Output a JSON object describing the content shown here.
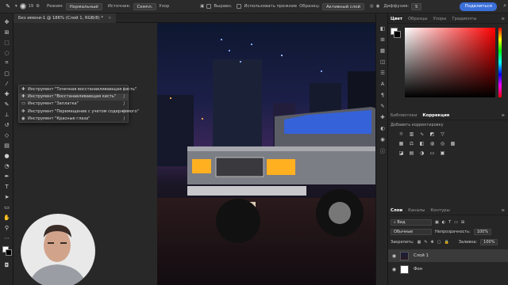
{
  "options_bar": {
    "brush_size": "19",
    "mode_label": "Режим:",
    "mode_value": "Нормальный",
    "source_label": "Источник:",
    "source_value": "Семпл.",
    "source_alt": "Узор",
    "align_label": "Выравн.",
    "use_legacy_label": "Использовать прежние",
    "sample_label": "Образец:",
    "sample_value": "Активный слой",
    "diffusion_label": "Диффузия:",
    "diffusion_value": "5",
    "share_label": "Поделиться"
  },
  "document": {
    "tab_title": "Без имени-1 @ 186% (Слой 1, RGB/8) *",
    "close_icon": "close-icon"
  },
  "fly_menu": {
    "items": [
      {
        "label": "Инструмент \"Точечная восстанавливающая кисть\"",
        "key": "J"
      },
      {
        "label": "Инструмент \"Восстанавливающая кисть\"",
        "key": "J",
        "active": true
      },
      {
        "label": "Инструмент \"Заплатка\"",
        "key": "J"
      },
      {
        "label": "Инструмент \"Перемещение с учетом содержимого\"",
        "key": "J"
      },
      {
        "label": "Инструмент \"Красные глаза\"",
        "key": "J"
      }
    ]
  },
  "photo": {
    "plate_text": "ЕЗ9-П4"
  },
  "color_panel": {
    "tabs": [
      "Цвет",
      "Образцы",
      "Узоры",
      "Градиенты"
    ],
    "active": "Цвет",
    "color_accent": "#ff0000"
  },
  "adjust_panel": {
    "tabs": [
      "Библиотеки",
      "Коррекция"
    ],
    "active": "Коррекция",
    "hint": "Добавить корректировку"
  },
  "layers_panel": {
    "tabs": [
      "Слои",
      "Каналы",
      "Контуры"
    ],
    "active": "Слои",
    "filter_placeholder": "Вид",
    "blend_mode": "Обычные",
    "opacity_label": "Непрозрачность:",
    "opacity_value": "100%",
    "lock_label": "Закрепить:",
    "fill_label": "Заливка:",
    "fill_value": "100%",
    "layers": [
      {
        "name": "Слой 1",
        "selected": true
      },
      {
        "name": "Фон",
        "selected": false
      }
    ]
  }
}
